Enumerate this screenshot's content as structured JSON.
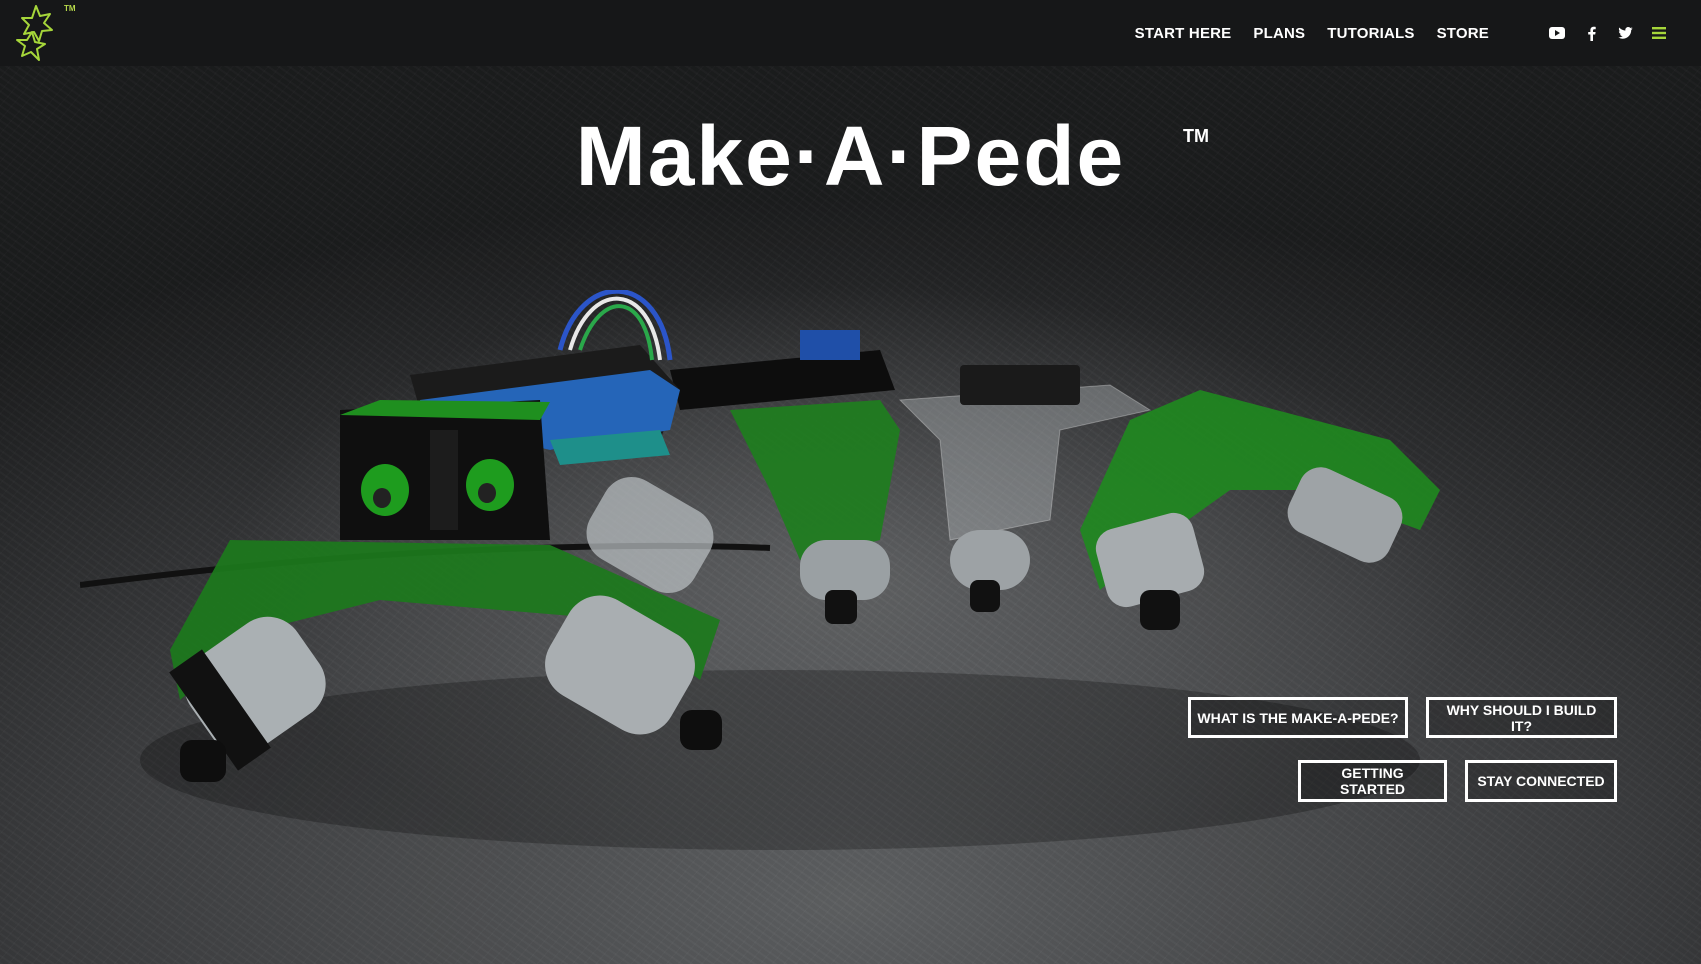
{
  "brand": {
    "logo_icon": "star-cluster-logo-icon",
    "tm": "TM",
    "accent_color": "#a6d63a"
  },
  "nav": {
    "links": [
      "START HERE",
      "PLANS",
      "TUTORIALS",
      "STORE"
    ],
    "icons": [
      "youtube-icon",
      "facebook-icon",
      "twitter-icon",
      "menu-icon"
    ]
  },
  "hero": {
    "title": "Make·A·Pede",
    "title_tm": "TM",
    "image_subject": "make-a-pede-robot"
  },
  "buttons": {
    "what_is": "WHAT IS THE MAKE-A-PEDE?",
    "why_build": "WHY SHOULD I BUILD IT?",
    "getting_started": "GETTING STARTED",
    "stay_connected": "STAY CONNECTED"
  }
}
